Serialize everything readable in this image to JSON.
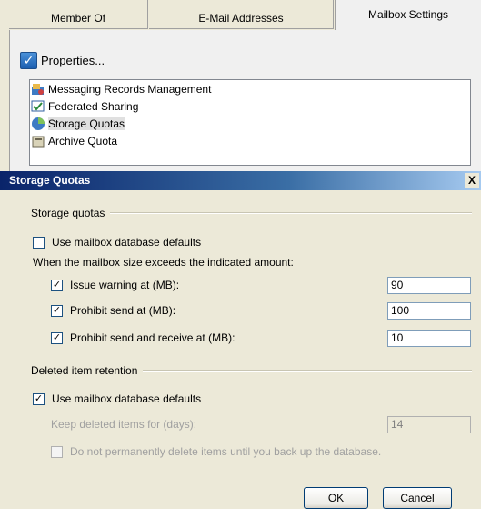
{
  "tabs": [
    {
      "label": "Member Of"
    },
    {
      "label": "E-Mail Addresses"
    },
    {
      "label": "Mailbox Settings"
    }
  ],
  "properties_button": {
    "label_first": "P",
    "label_rest": "roperties..."
  },
  "settings_list": [
    {
      "label": "Messaging Records Management",
      "icon": "records-management-icon"
    },
    {
      "label": "Federated Sharing",
      "icon": "federated-sharing-icon"
    },
    {
      "label": "Storage Quotas",
      "icon": "storage-quotas-icon",
      "selected": true
    },
    {
      "label": "Archive Quota",
      "icon": "archive-quota-icon"
    }
  ],
  "dialog": {
    "title": "Storage Quotas",
    "close_label": "X",
    "storage_group": "Storage quotas",
    "use_db_defaults_quota": {
      "label": "Use mailbox database defaults",
      "checked": false
    },
    "exceeds_text": "When the mailbox size exceeds the indicated amount:",
    "issue_warning": {
      "label": "Issue warning at (MB):",
      "checked": true,
      "value": "90"
    },
    "prohibit_send": {
      "label": "Prohibit send at (MB):",
      "checked": true,
      "value": "100"
    },
    "prohibit_send_receive": {
      "label": "Prohibit send and receive at (MB):",
      "checked": true,
      "value": "10"
    },
    "retention_group": "Deleted item retention",
    "use_db_defaults_retention": {
      "label": "Use mailbox database defaults",
      "checked": true
    },
    "keep_deleted": {
      "label": "Keep deleted items for (days):",
      "value": "14"
    },
    "no_perm_delete": {
      "label": "Do not permanently delete items until you back up the database.",
      "checked": false
    },
    "ok_label": "OK",
    "cancel_label": "Cancel"
  }
}
